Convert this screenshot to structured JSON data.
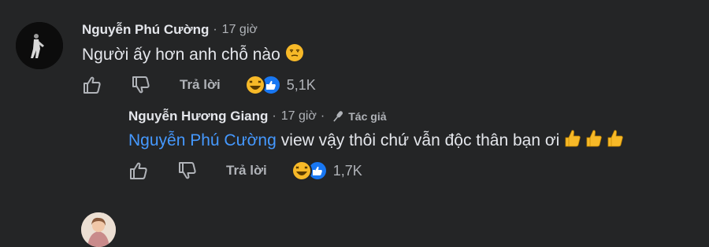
{
  "comments": [
    {
      "author": "Nguyễn Phú Cường",
      "separator": "·",
      "time": "17 giờ",
      "text": "Người ấy hơn anh chỗ nào",
      "text_emoji": "unamused-face-icon",
      "actions": {
        "reply_label": "Trả lời",
        "reaction_count": "5,1K"
      }
    },
    {
      "author": "Nguyễn Hương Giang",
      "separator": "·",
      "time": "17 giờ",
      "author_badge": "Tác giả",
      "mention": "Nguyễn Phú Cường",
      "text": "view vậy thôi chứ vẫn độc thân bạn ơi",
      "text_emoji": "thumbs-up-icon x3",
      "actions": {
        "reply_label": "Trả lời",
        "reaction_count": "1,7K"
      }
    }
  ],
  "colors": {
    "background": "#242526",
    "text": "#e4e6eb",
    "muted": "#b0b3b8",
    "mention": "#4599ff",
    "like_blue": "#1877f2",
    "haha_yellow": "#f7b928"
  }
}
